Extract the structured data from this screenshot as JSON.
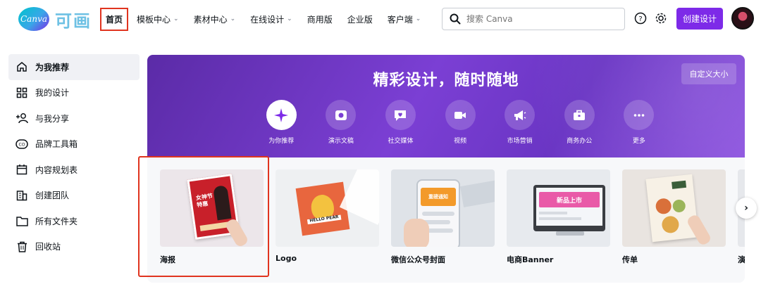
{
  "header": {
    "logo": "Canva",
    "logo_cn": "可画",
    "nav": [
      {
        "label": "首页",
        "dropdown": false
      },
      {
        "label": "模板中心",
        "dropdown": true
      },
      {
        "label": "素材中心",
        "dropdown": true
      },
      {
        "label": "在线设计",
        "dropdown": true
      },
      {
        "label": "商用版",
        "dropdown": false
      },
      {
        "label": "企业版",
        "dropdown": false
      },
      {
        "label": "客户端",
        "dropdown": true
      }
    ],
    "search_placeholder": "搜索 Canva",
    "create_label": "创建设计"
  },
  "sidebar": {
    "items": [
      {
        "label": "为我推荐",
        "icon": "home-icon"
      },
      {
        "label": "我的设计",
        "icon": "grid-icon"
      },
      {
        "label": "与我分享",
        "icon": "share-users-icon"
      },
      {
        "label": "品牌工具箱",
        "icon": "brand-icon"
      },
      {
        "label": "内容规划表",
        "icon": "calendar-icon"
      },
      {
        "label": "创建团队",
        "icon": "building-icon"
      },
      {
        "label": "所有文件夹",
        "icon": "folder-icon"
      },
      {
        "label": "回收站",
        "icon": "trash-icon"
      }
    ]
  },
  "banner": {
    "title": "精彩设计，随时随地",
    "custom_size": "自定义大小",
    "categories": [
      {
        "label": "为你推荐",
        "icon": "sparkle-icon"
      },
      {
        "label": "演示文稿",
        "icon": "presentation-icon"
      },
      {
        "label": "社交媒体",
        "icon": "heart-chat-icon"
      },
      {
        "label": "视频",
        "icon": "video-icon"
      },
      {
        "label": "市场营销",
        "icon": "megaphone-icon"
      },
      {
        "label": "商务办公",
        "icon": "briefcase-icon"
      },
      {
        "label": "更多",
        "icon": "more-icon"
      }
    ]
  },
  "templates": [
    {
      "label": "海报"
    },
    {
      "label": "Logo"
    },
    {
      "label": "微信公众号封面"
    },
    {
      "label": "电商Banner"
    },
    {
      "label": "传单"
    },
    {
      "label": "演"
    }
  ],
  "thumb_text": {
    "poster_title": "女神节特惠",
    "logo_text": "HELLO PEAR",
    "wechat_title": "重磅通知",
    "banner_text": "新品上市"
  },
  "colors": {
    "accent": "#7d2ae8",
    "highlight": "#e0341f",
    "banner_bg": "#6a35c4"
  }
}
